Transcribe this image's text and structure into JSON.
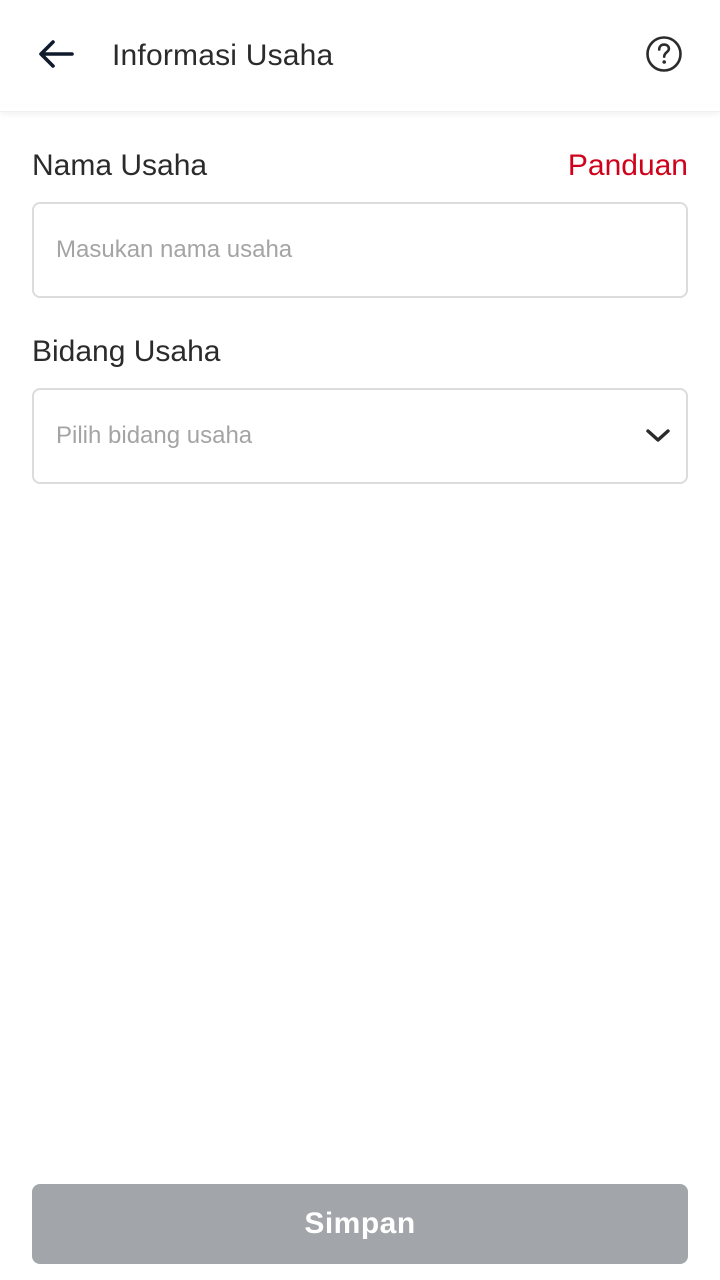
{
  "header": {
    "title": "Informasi Usaha",
    "back_icon": "arrow-left-icon",
    "help_icon": "question-circle-icon"
  },
  "form": {
    "nama_usaha": {
      "label": "Nama Usaha",
      "guide_link": "Panduan",
      "value": "",
      "placeholder": "Masukan nama usaha"
    },
    "bidang_usaha": {
      "label": "Bidang Usaha",
      "placeholder": "Pilih bidang usaha",
      "dropdown_icon": "chevron-down-icon"
    }
  },
  "actions": {
    "save_label": "Simpan",
    "save_enabled": false
  },
  "colors": {
    "accent": "#d0021b",
    "text_primary": "#2b2b2b",
    "placeholder": "#a4a4a4",
    "border": "#dcdcdc",
    "button_disabled": "#a2a5a9",
    "icon_dark": "#0f1b2d"
  }
}
